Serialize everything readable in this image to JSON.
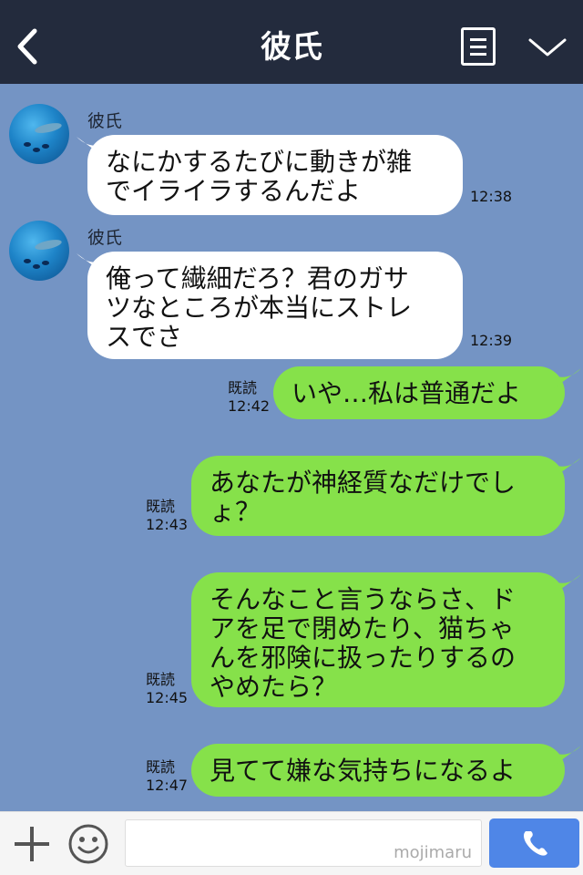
{
  "header": {
    "title": "彼氏"
  },
  "messages": [
    {
      "sender": "彼氏",
      "lines": [
        "なにかするたびに動きが雑",
        "でイライラするんだよ"
      ],
      "time": "12:38"
    },
    {
      "sender": "彼氏",
      "lines": [
        "俺って繊細だろ？君のガサ",
        "ツなところが本当にストレ",
        "スでさ"
      ],
      "time": "12:39"
    },
    {
      "read": "既読",
      "lines": [
        "いや…私は普通だよ"
      ],
      "time": "12:42"
    },
    {
      "read": "既読",
      "lines": [
        "あなたが神経質なだけでし",
        "ょ？"
      ],
      "time": "12:43"
    },
    {
      "read": "既読",
      "lines": [
        "そんなこと言うならさ、ド",
        "アを足で閉めたり、猫ちゃ",
        "んを邪険に扱ったりするの",
        "やめたら？"
      ],
      "time": "12:45"
    },
    {
      "read": "既読",
      "lines": [
        "見てて嫌な気持ちになるよ"
      ],
      "time": "12:47"
    }
  ],
  "footer": {
    "watermark": "mojimaru"
  },
  "colors": {
    "header": "#232b3d",
    "background": "#7494c4",
    "incoming": "#ffffff",
    "outgoing": "#86e14a",
    "send": "#4f86e7"
  },
  "icons": {
    "back": "chevron-left-icon",
    "menu": "menu-list-icon",
    "collapse": "chevron-down-icon",
    "add": "plus-icon",
    "sticker": "smiley-icon",
    "call": "phone-icon"
  }
}
